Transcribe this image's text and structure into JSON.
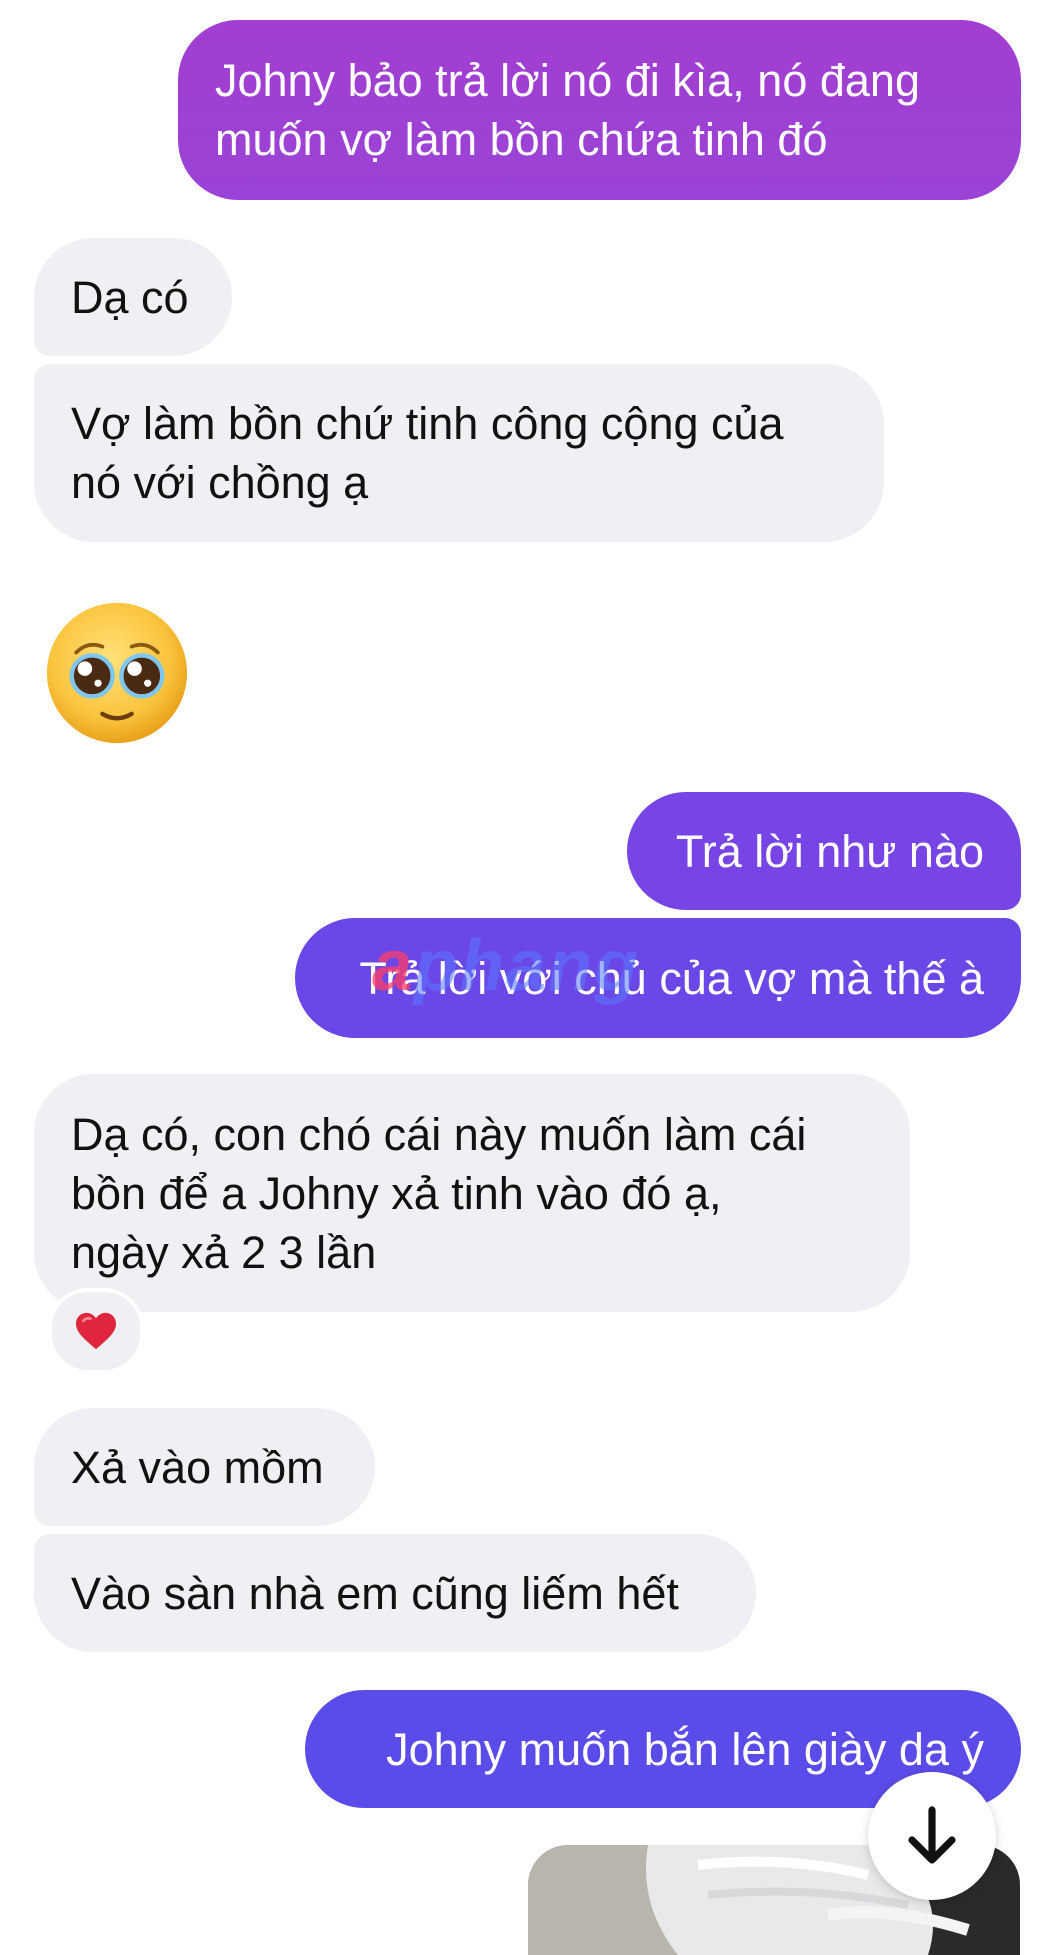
{
  "messages": [
    {
      "id": "m1",
      "direction": "outgoing",
      "lines": [
        "Johny bảo trả lời nó đi kìa, nó đang",
        "muốn vợ làm bồn chứa tinh đó"
      ]
    },
    {
      "id": "m2",
      "direction": "incoming",
      "lines": [
        "Dạ có"
      ]
    },
    {
      "id": "m3",
      "direction": "incoming",
      "lines": [
        "Vợ làm bồn chứ tinh công cộng của",
        "nó với chồng ạ"
      ]
    },
    {
      "id": "emoji",
      "direction": "incoming",
      "emoji": "pleading-face-emoji"
    },
    {
      "id": "m4",
      "direction": "outgoing",
      "lines": [
        "Trả lời như nào"
      ]
    },
    {
      "id": "m5",
      "direction": "outgoing",
      "lines": [
        "Trả lời với chủ của vợ mà thế à"
      ]
    },
    {
      "id": "m6",
      "direction": "incoming",
      "lines": [
        "Dạ có, con chó cái này muốn làm cái",
        "bồn để a Johny xả tinh vào đó ạ,",
        "ngày xả 2 3 lần"
      ],
      "reaction": "heart-icon"
    },
    {
      "id": "m7",
      "direction": "incoming",
      "lines": [
        "Xả vào mồm"
      ]
    },
    {
      "id": "m8",
      "direction": "incoming",
      "lines": [
        "Vào sàn nhà em cũng liếm hết"
      ]
    },
    {
      "id": "m9",
      "direction": "outgoing",
      "lines": [
        "Johny muốn bắn lên giày da ý"
      ]
    }
  ],
  "watermark": {
    "prefix": "a",
    "text": "phang"
  },
  "scroll_button": {
    "icon": "arrow-down-icon"
  },
  "colors": {
    "incoming_bg": "#efeff4",
    "outgoing_top": "#a23ed1",
    "outgoing_bottom": "#5a4ce8",
    "heart": "#e0263c"
  }
}
